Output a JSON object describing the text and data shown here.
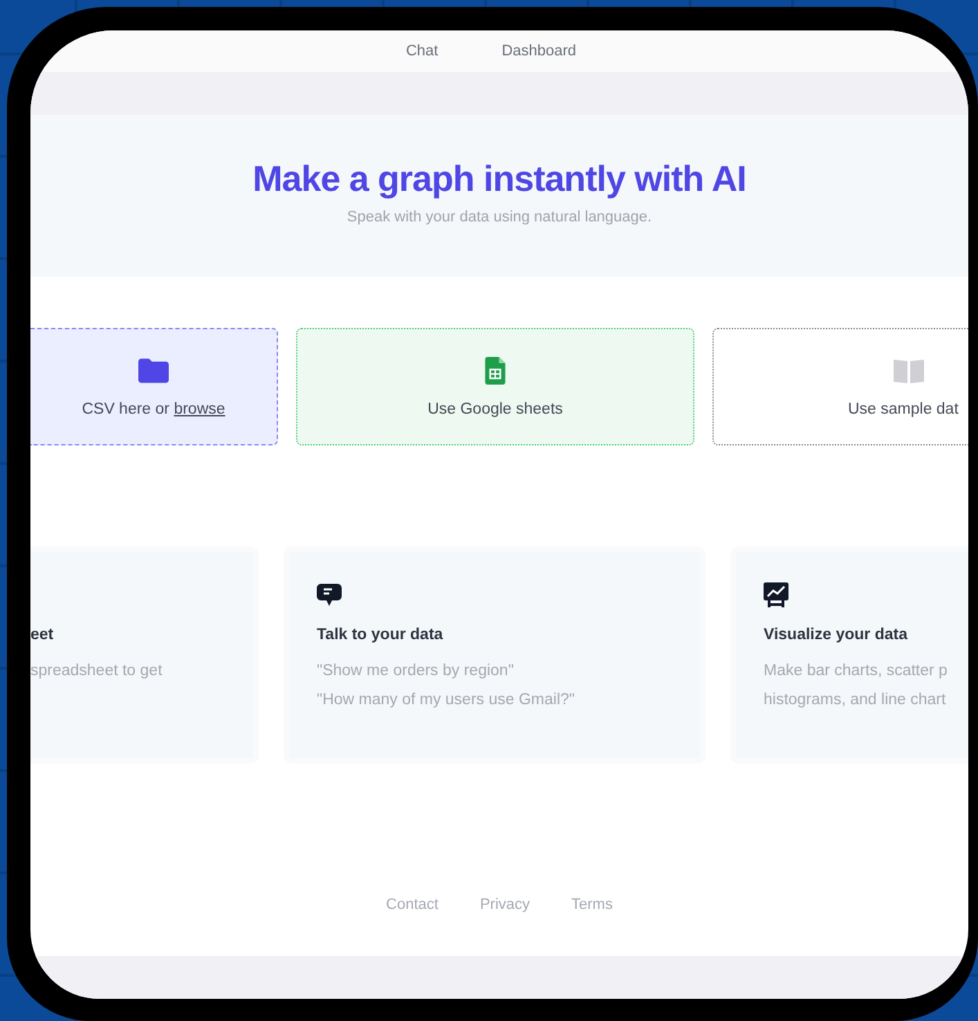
{
  "nav": [
    "Chat",
    "Dashboard"
  ],
  "hero": {
    "title": "Make a graph instantly with AI",
    "subtitle": "Speak with your data using natural language."
  },
  "sources": [
    {
      "kind": "upload",
      "label": "CSV here or ",
      "link": "browse"
    },
    {
      "kind": "sheets",
      "label": "Use Google sheets"
    },
    {
      "kind": "sample",
      "label": "Use sample dat"
    }
  ],
  "features": [
    {
      "kind": "partial",
      "title": "eet",
      "lines": [
        "spreadsheet to get"
      ]
    },
    {
      "kind": "chat",
      "title": "Talk to your data",
      "lines": [
        "\"Show me orders by region\"",
        "\"How many of my users use Gmail?\""
      ]
    },
    {
      "kind": "chart",
      "title": "Visualize your data",
      "lines": [
        "Make bar charts, scatter p",
        "histograms, and line chart"
      ]
    }
  ],
  "footer_links": [
    "Contact",
    "Privacy",
    "Terms"
  ]
}
